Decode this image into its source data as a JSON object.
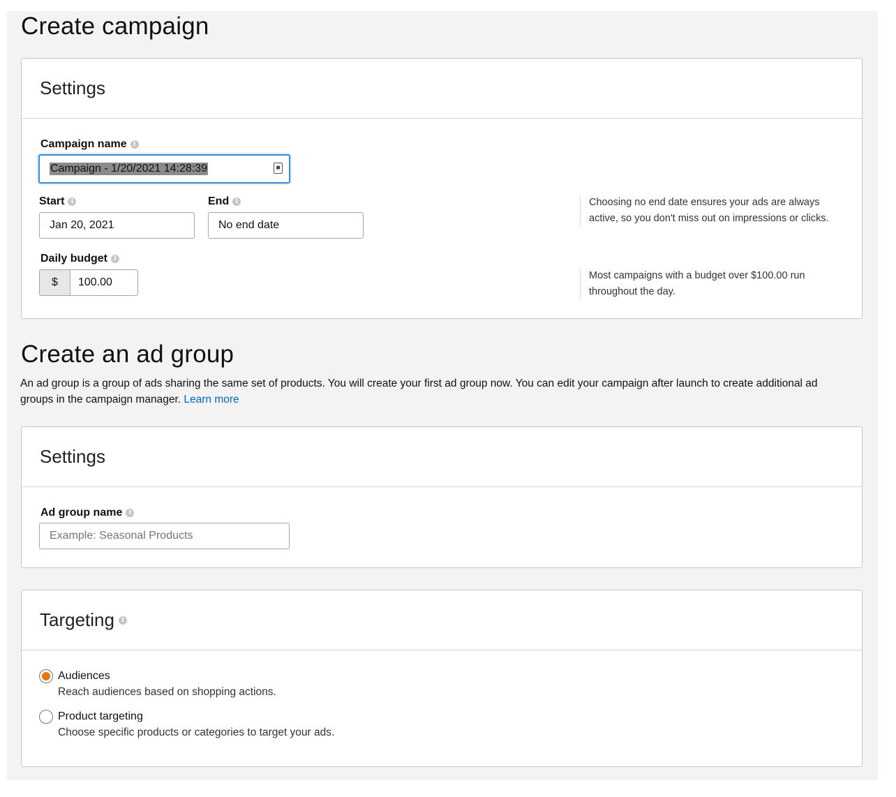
{
  "campaign": {
    "title": "Create campaign",
    "settings_title": "Settings",
    "name_label": "Campaign name",
    "name_value": "Campaign - 1/20/2021 14:28:39",
    "start_label": "Start",
    "start_value": "Jan 20, 2021",
    "end_label": "End",
    "end_value": "No end date",
    "end_help": "Choosing no end date ensures your ads are always active, so you don't miss out on impressions or clicks.",
    "budget_label": "Daily budget",
    "currency": "$",
    "budget_value": "100.00",
    "budget_help": "Most campaigns with a budget over $100.00 run throughout the day."
  },
  "ad_group": {
    "title": "Create an ad group",
    "description": "An ad group is a group of ads sharing the same set of products. You will create your first ad group now. You can edit your campaign after launch to create additional ad groups in the campaign manager.",
    "learn_more": "Learn more",
    "settings_title": "Settings",
    "name_label": "Ad group name",
    "name_placeholder": "Example: Seasonal Products"
  },
  "targeting": {
    "title": "Targeting",
    "options": [
      {
        "label": "Audiences",
        "description": "Reach audiences based on shopping actions.",
        "selected": true
      },
      {
        "label": "Product targeting",
        "description": "Choose specific products or categories to target your ads.",
        "selected": false
      }
    ]
  },
  "colors": {
    "accent": "#e47911",
    "link": "#0066c0",
    "focus": "#3a8fd6",
    "selection": "#8a8a8a"
  },
  "icons": {
    "info": "info-icon",
    "contact_card": "contact-card-icon"
  }
}
